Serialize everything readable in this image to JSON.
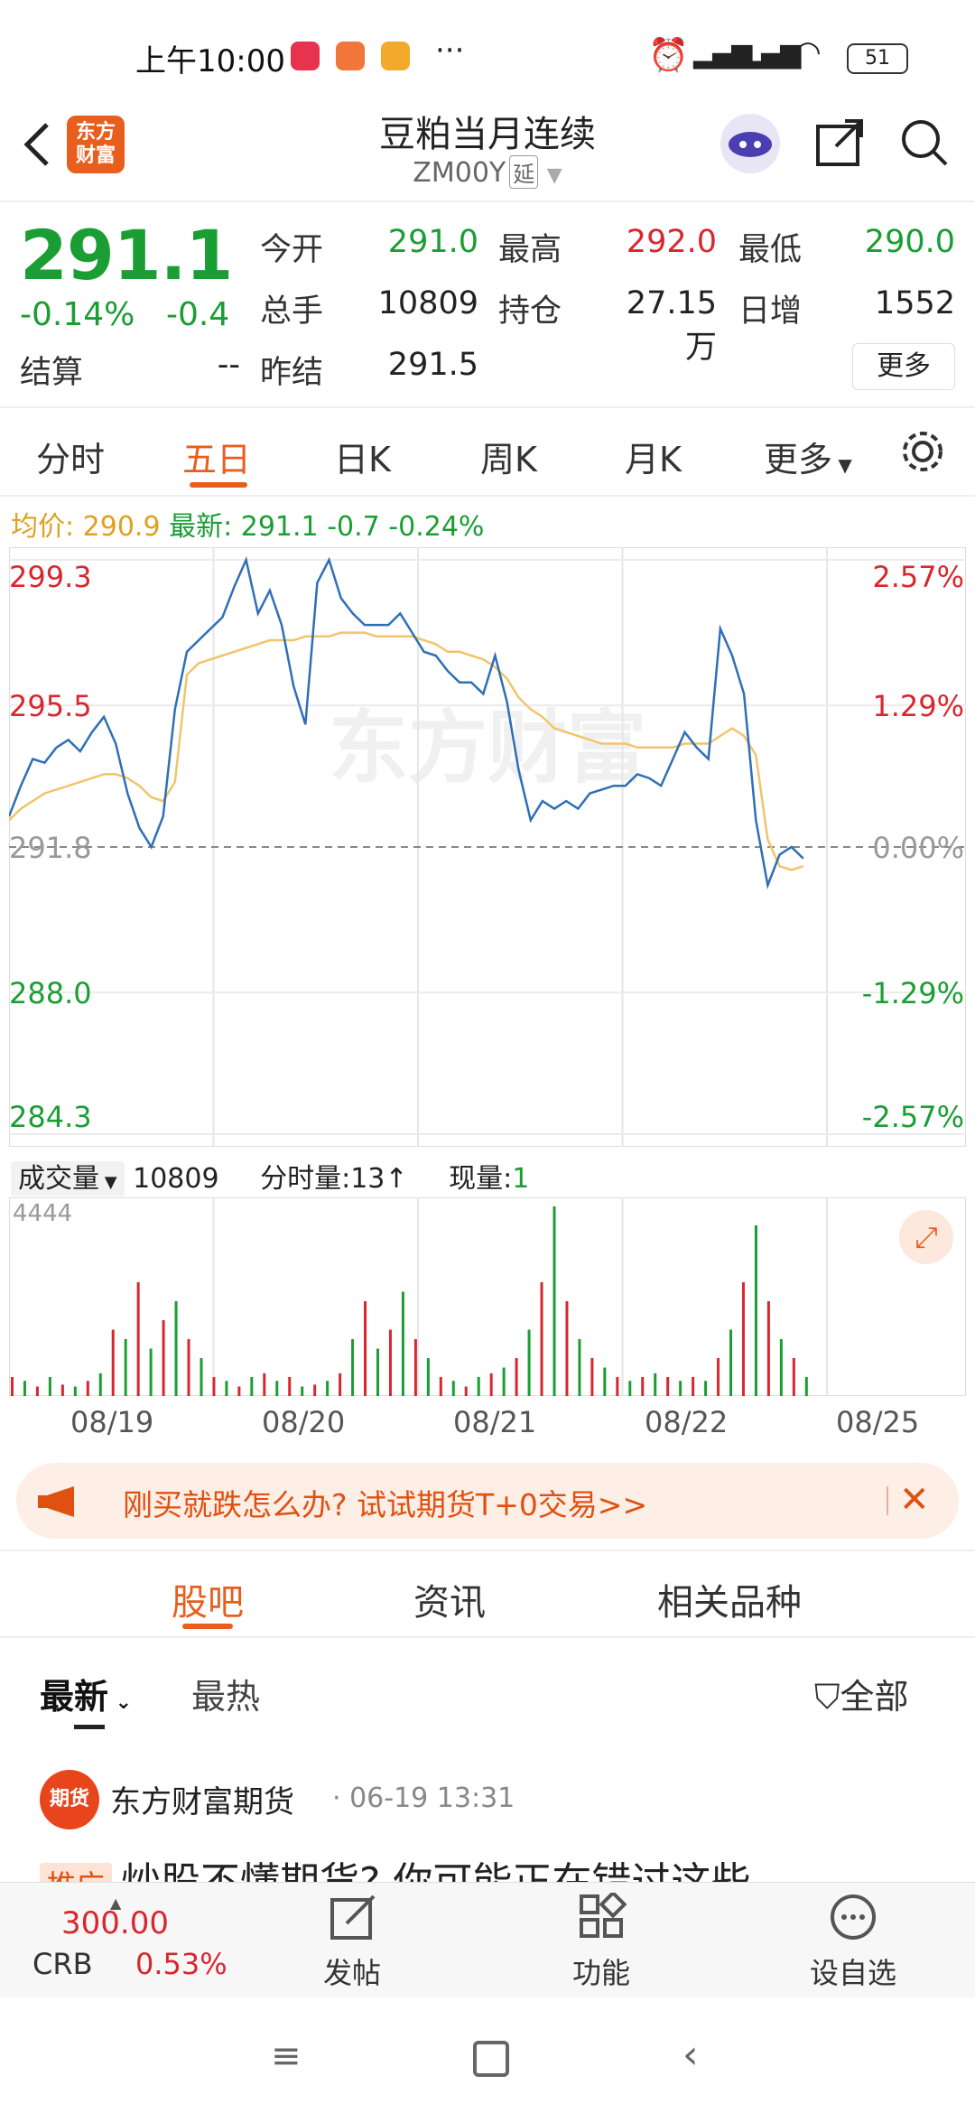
{
  "status_bar": {
    "time": "上午10:00",
    "battery": "51"
  },
  "header": {
    "logo_text": "东方财富",
    "title": "豆粕当月连续",
    "code": "ZM00Y",
    "delay_tag": "延"
  },
  "quote": {
    "last": "291.1",
    "change_pct": "-0.14%",
    "change": "-0.4",
    "fields": [
      {
        "label": "今开",
        "value": "291.0",
        "color": "green"
      },
      {
        "label": "最高",
        "value": "292.0",
        "color": "red"
      },
      {
        "label": "最低",
        "value": "290.0",
        "color": "green"
      },
      {
        "label": "总手",
        "value": "10809",
        "color": "black"
      },
      {
        "label": "持仓",
        "value": "27.15万",
        "color": "black"
      },
      {
        "label": "日增",
        "value": "1552",
        "color": "black"
      }
    ],
    "settle_label": "结算",
    "settle_value": "--",
    "prev_settle_label": "昨结",
    "prev_settle_value": "291.5",
    "more_label": "更多"
  },
  "tabs": [
    "分时",
    "五日",
    "日K",
    "周K",
    "月K",
    "更多"
  ],
  "active_tab": "五日",
  "info_row": {
    "avg_label": "均价:",
    "avg_value": "290.9",
    "latest_label": "最新:",
    "latest_value": "291.1",
    "delta": "-0.7",
    "delta_pct": "-0.24%"
  },
  "chart_data": {
    "type": "line",
    "y_left_ticks": [
      "299.3",
      "295.5",
      "291.8",
      "288.0",
      "284.3"
    ],
    "y_right_ticks": [
      "2.57%",
      "1.29%",
      "0.00%",
      "-1.29%",
      "-2.57%"
    ],
    "x_labels": [
      "08/19",
      "08/20",
      "08/21",
      "08/22",
      "08/25"
    ],
    "ylim": [
      284.3,
      299.3
    ],
    "baseline": 291.8,
    "watermark": "东方财富",
    "series": [
      {
        "name": "最新",
        "color": "#2f6fb8",
        "values": [
          292.6,
          293.4,
          294.1,
          294.0,
          294.4,
          294.6,
          294.3,
          294.8,
          295.2,
          294.5,
          293.2,
          292.3,
          291.8,
          292.6,
          295.4,
          296.9,
          297.2,
          297.5,
          297.8,
          298.6,
          299.3,
          297.9,
          298.5,
          297.6,
          296.0,
          295.0,
          298.7,
          299.3,
          298.3,
          297.9,
          297.6,
          297.6,
          297.6,
          297.9,
          297.4,
          296.9,
          296.8,
          296.4,
          296.1,
          296.1,
          295.8,
          296.8,
          295.6,
          293.8,
          292.5,
          293.0,
          292.8,
          293.0,
          292.8,
          293.2,
          293.3,
          293.4,
          293.4,
          293.7,
          293.6,
          293.4,
          294.1,
          294.8,
          294.4,
          294.1,
          297.5,
          296.8,
          295.8,
          292.5,
          290.8,
          291.6,
          291.8,
          291.5
        ]
      },
      {
        "name": "均价",
        "color": "#f2c46b",
        "values": [
          292.5,
          292.8,
          293.0,
          293.2,
          293.3,
          293.4,
          293.5,
          293.6,
          293.7,
          293.7,
          293.6,
          293.4,
          293.1,
          293.0,
          293.5,
          296.3,
          296.6,
          296.7,
          296.8,
          296.9,
          297.0,
          297.1,
          297.2,
          297.2,
          297.2,
          297.3,
          297.3,
          297.3,
          297.4,
          297.4,
          297.4,
          297.3,
          297.3,
          297.3,
          297.3,
          297.2,
          297.1,
          296.9,
          296.9,
          296.8,
          296.7,
          296.5,
          296.2,
          295.7,
          295.4,
          295.2,
          294.9,
          294.8,
          294.7,
          294.6,
          294.5,
          294.5,
          294.5,
          294.4,
          294.4,
          294.4,
          294.4,
          294.5,
          294.5,
          294.5,
          294.7,
          294.9,
          294.7,
          294.2,
          292.0,
          291.3,
          291.2,
          291.3
        ]
      }
    ]
  },
  "volume": {
    "label": "成交量",
    "total": "10809",
    "min_vol_label": "分时量:",
    "min_vol_value": "13",
    "cur_label": "现量:",
    "cur_value": "1",
    "max_tick": "4444",
    "values": [
      0.1,
      0.08,
      0.05,
      0.1,
      0.06,
      0.05,
      0.08,
      0.12,
      0.35,
      0.3,
      0.6,
      0.25,
      0.4,
      0.5,
      0.3,
      0.2,
      0.1,
      0.08,
      0.05,
      0.1,
      0.12,
      0.08,
      0.1,
      0.05,
      0.06,
      0.08,
      0.12,
      0.3,
      0.5,
      0.25,
      0.35,
      0.55,
      0.3,
      0.2,
      0.1,
      0.08,
      0.05,
      0.1,
      0.12,
      0.15,
      0.2,
      0.35,
      0.6,
      1.0,
      0.5,
      0.3,
      0.2,
      0.15,
      0.1,
      0.08,
      0.1,
      0.12,
      0.1,
      0.08,
      0.1,
      0.08,
      0.2,
      0.35,
      0.6,
      0.9,
      0.5,
      0.3,
      0.2,
      0.1
    ]
  },
  "banner": {
    "text": "刚买就跌怎么办? 试试期货T+0交易>>"
  },
  "section_tabs": [
    "股吧",
    "资讯",
    "相关品种"
  ],
  "active_section": "股吧",
  "sort": {
    "latest": "最新",
    "hot": "最热",
    "filter": "全部"
  },
  "post": {
    "avatar_text": "期货",
    "author": "东方财富期货",
    "time": "06-19 13:31",
    "tag": "推广",
    "title": "炒股不懂期货? 你可能正在错过这些"
  },
  "bottom_bar": {
    "crb_value": "300.00",
    "crb_label": "CRB",
    "crb_pct": "0.53%",
    "post_label": "发帖",
    "func_label": "功能",
    "watch_label": "设自选"
  }
}
